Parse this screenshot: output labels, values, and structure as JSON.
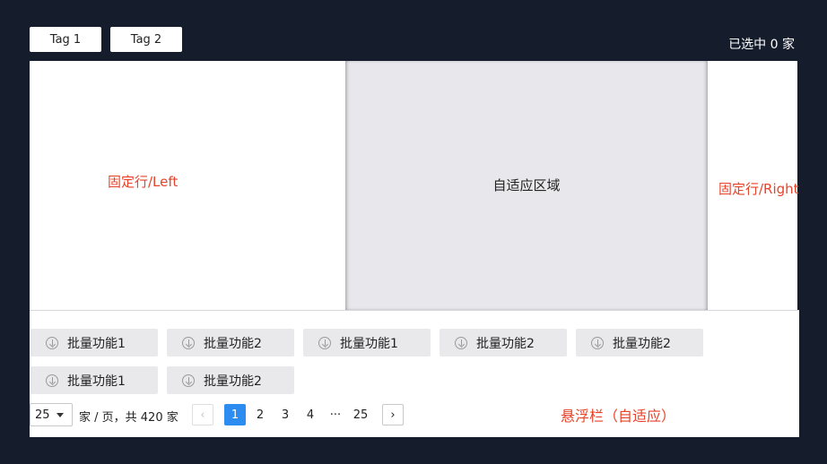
{
  "tags": [
    {
      "label": "Tag 1"
    },
    {
      "label": "Tag 2"
    }
  ],
  "selected_count_text": "已选中 0 家",
  "regions": {
    "left_label": "固定行/Left",
    "middle_label": "自适应区域",
    "right_label": "固定行/Right",
    "floating_label": "悬浮栏（自适应）"
  },
  "batch_buttons": [
    {
      "label": "批量功能1",
      "icon": "download-icon"
    },
    {
      "label": "批量功能2",
      "icon": "download-icon"
    },
    {
      "label": "批量功能1",
      "icon": "download-icon"
    },
    {
      "label": "批量功能2",
      "icon": "download-icon"
    },
    {
      "label": "批量功能2",
      "icon": "download-icon"
    },
    {
      "label": "批量功能1",
      "icon": "download-icon"
    },
    {
      "label": "批量功能2",
      "icon": "download-icon"
    }
  ],
  "pagination": {
    "page_size": "25",
    "summary": "家 / 页，共 420 家",
    "prev": "‹",
    "pages": [
      "1",
      "2",
      "3",
      "4"
    ],
    "ellipsis": "···",
    "last_page": "25",
    "next": "›",
    "current_page": "1"
  },
  "colors": {
    "background": "#151c2c",
    "accent": "#2d8cf0",
    "annotation_red": "#e8432a",
    "middle_panel": "#e8e8ec"
  }
}
